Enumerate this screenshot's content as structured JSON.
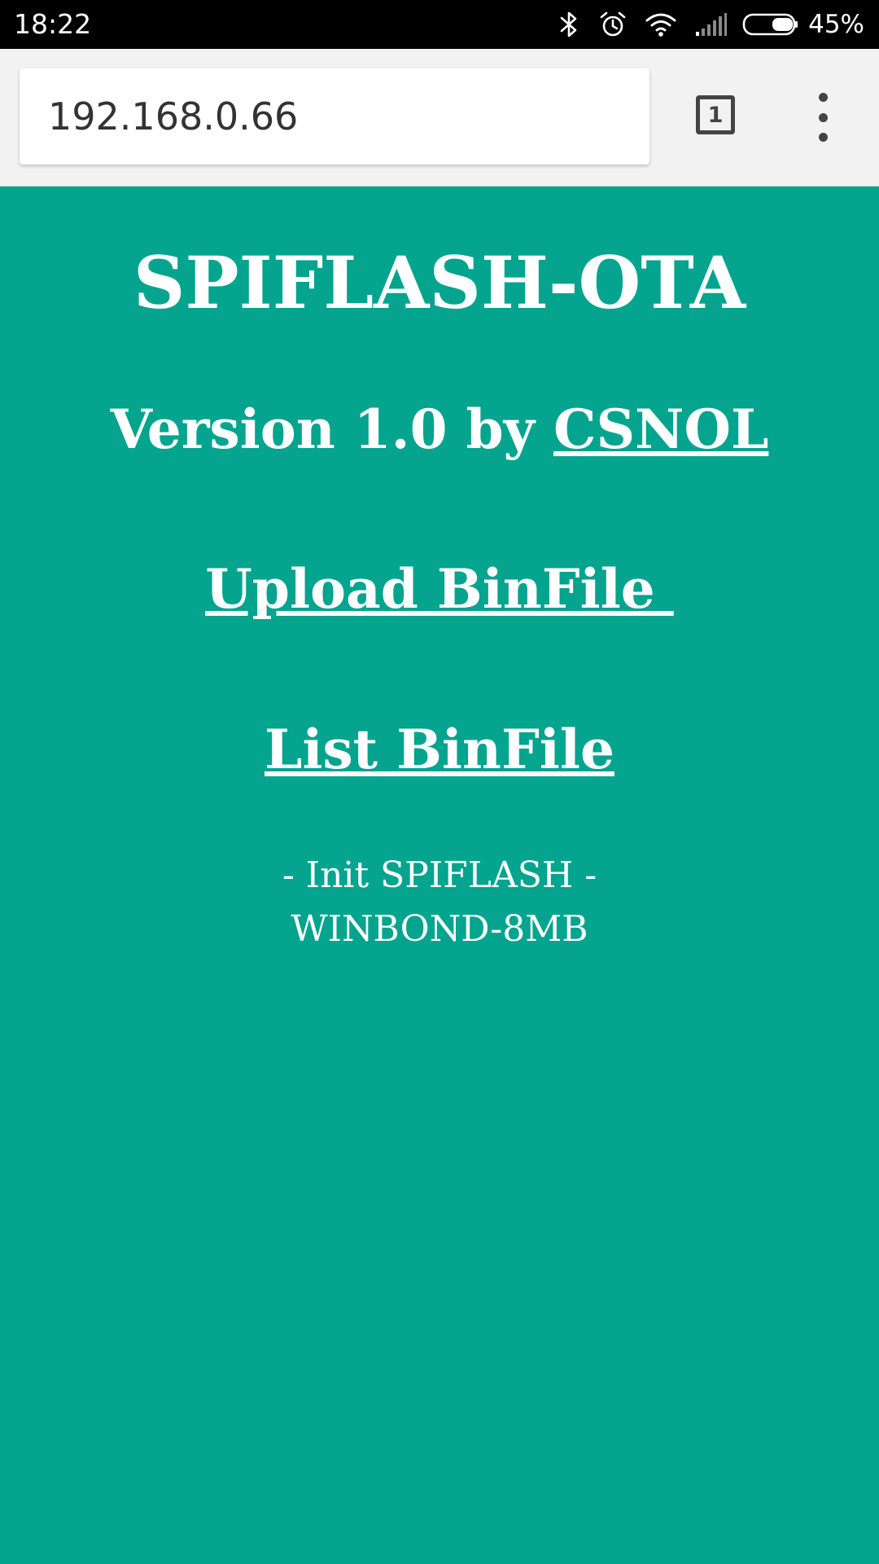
{
  "status_bar": {
    "time": "18:22",
    "battery_percent": "45%",
    "battery_level": 0.45,
    "icons": [
      "bluetooth-icon",
      "alarm-icon",
      "wifi-icon",
      "cell-signal-icon",
      "battery-icon"
    ]
  },
  "browser": {
    "url": "192.168.0.66",
    "tab_count": "1",
    "menu_icon": "overflow-menu-icon"
  },
  "page": {
    "background_color": "#04a48e",
    "title": "SPIFLASH-OTA",
    "version_prefix": "Version 1.0 by ",
    "author": "CSNOL",
    "upload_link": "Upload BinFile ",
    "list_link": "List BinFile",
    "status_line_1": "- Init SPIFLASH -",
    "status_line_2": "WINBOND-8MB"
  }
}
